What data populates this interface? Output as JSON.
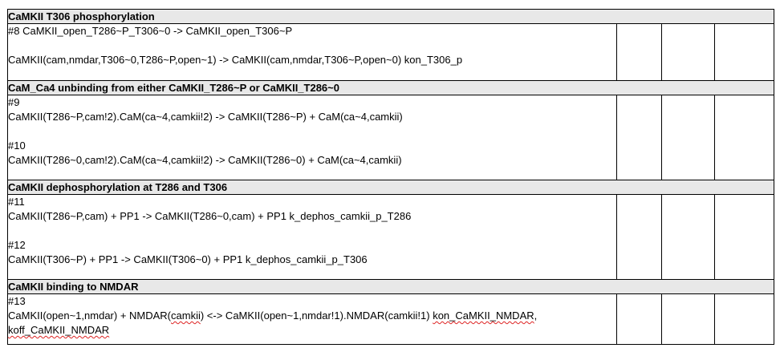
{
  "sections": [
    {
      "title": "CaMKII T306 phosphorylation",
      "lines": [
        "#8 CaMKII_open_T286~P_T306~0 -> CaMKII_open_T306~P",
        "",
        "CaMKII(cam,nmdar,T306~0,T286~P,open~1) -> CaMKII(cam,nmdar,T306~P,open~0) kon_T306_p"
      ]
    },
    {
      "title": "CaM_Ca4 unbinding from either CaMKII_T286~P or CaMKII_T286~0",
      "lines": [
        "#9",
        "CaMKII(T286~P,cam!2).CaM(ca~4,camkii!2) -> CaMKII(T286~P) + CaM(ca~4,camkii)",
        "",
        "#10",
        "CaMKII(T286~0,cam!2).CaM(ca~4,camkii!2) -> CaMKII(T286~0) + CaM(ca~4,camkii)"
      ]
    },
    {
      "title": "CaMKII dephosphorylation at T286 and T306",
      "lines": [
        "#11",
        "CaMKII(T286~P,cam) + PP1 -> CaMKII(T286~0,cam) + PP1 k_dephos_camkii_p_T286",
        "",
        "#12",
        "CaMKII(T306~P) + PP1 -> CaMKII(T306~0) + PP1 k_dephos_camkii_p_T306"
      ]
    },
    {
      "title": "CaMKII binding to NMDAR",
      "lines": [
        "#13"
      ],
      "rule": {
        "before": "CaMKII(open~1,nmdar) + NMDAR(",
        "wavy1": "camkii",
        "middle": ") <-> CaMKII(open~1,nmdar!1).NMDAR(camkii!1) ",
        "wavy2": "kon_CaMKII_NMDAR",
        "after": ",",
        "wavy3": "koff_CaMKII_NMDAR"
      }
    }
  ]
}
